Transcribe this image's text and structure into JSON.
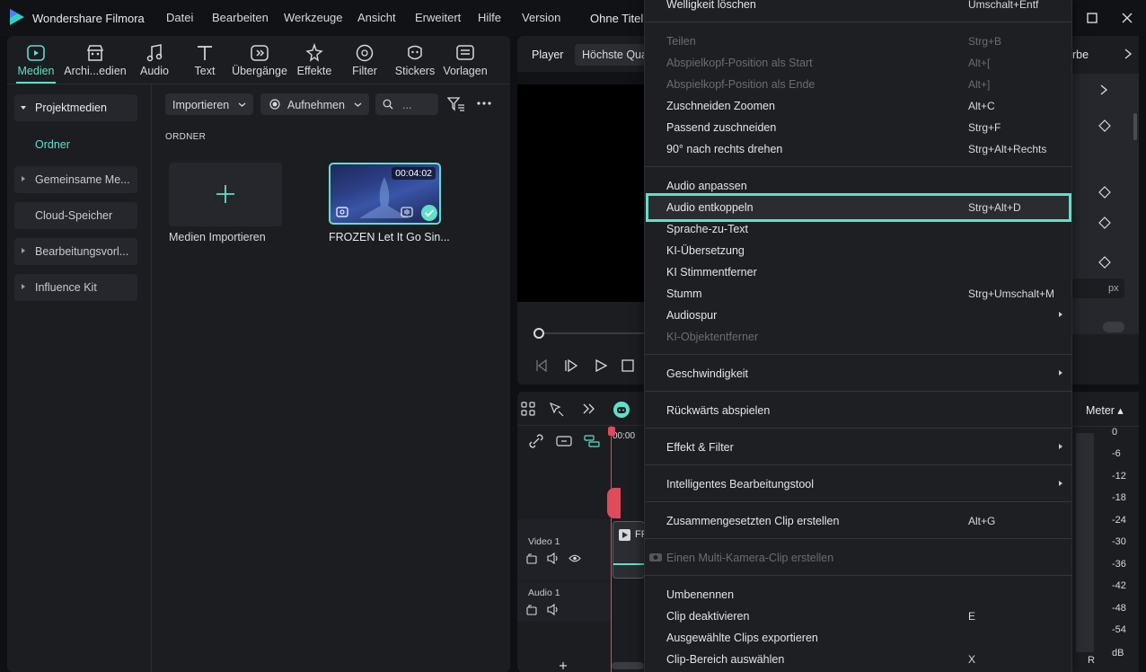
{
  "titlebar": {
    "app_title": "Wondershare Filmora",
    "menus": [
      "Datei",
      "Bearbeiten",
      "Werkzeuge",
      "Ansicht",
      "Erweitert",
      "Hilfe",
      "Version"
    ],
    "doc_title": "Ohne Titel"
  },
  "tabs": [
    {
      "label": "Medien",
      "icon": "media-icon",
      "active": true
    },
    {
      "label": "Archi...edien",
      "icon": "archive-icon"
    },
    {
      "label": "Audio",
      "icon": "music-note-icon"
    },
    {
      "label": "Text",
      "icon": "text-icon"
    },
    {
      "label": "Übergänge",
      "icon": "transition-icon"
    },
    {
      "label": "Effekte",
      "icon": "effects-icon"
    },
    {
      "label": "Filter",
      "icon": "filter-icon"
    },
    {
      "label": "Stickers",
      "icon": "sticker-icon"
    },
    {
      "label": "Vorlagen",
      "icon": "template-icon"
    }
  ],
  "sidebar": {
    "projektmedien": "Projektmedien",
    "ordner": "Ordner",
    "gemeinsame": "Gemeinsame Me...",
    "cloud": "Cloud-Speicher",
    "bearbeitung": "Bearbeitungsvorl...",
    "influence": "Influence Kit"
  },
  "media_toolbar": {
    "import_label": "Importieren",
    "record_label": "Aufnehmen",
    "search_placeholder": "..."
  },
  "media": {
    "section_label": "ORDNER",
    "import_tile_label": "Medien Importieren",
    "clip_label": "FROZEN  Let It Go Sin...",
    "clip_duration": "00:04:02"
  },
  "player": {
    "label": "Player",
    "quality": "Höchste Qualität"
  },
  "timeline": {
    "time": "00:00",
    "video_track": "Video 1",
    "audio_track": "Audio 1",
    "clip_prefix": "FF"
  },
  "right": {
    "tab_partial": "rbe",
    "px_unit": "px",
    "meter_label": "Meter",
    "db_scale": [
      "0",
      "-6",
      "-12",
      "-18",
      "-24",
      "-30",
      "-36",
      "-42",
      "-48",
      "-54",
      "dB"
    ],
    "channel_r": "R"
  },
  "context_menu": {
    "items": [
      {
        "label": "Welligkeit löschen",
        "shortcut": "Umschalt+Entf",
        "disabled": false
      },
      {
        "label": "Teilen",
        "shortcut": "Strg+B",
        "disabled": true
      },
      {
        "label": "Abspielkopf-Position als Start",
        "shortcut": "Alt+[",
        "disabled": true
      },
      {
        "label": "Abspielkopf-Position als Ende",
        "shortcut": "Alt+]",
        "disabled": true
      },
      {
        "label": "Zuschneiden  Zoomen",
        "shortcut": "Alt+C",
        "disabled": false
      },
      {
        "label": "Passend zuschneiden",
        "shortcut": "Strg+F",
        "disabled": false
      },
      {
        "label": "90° nach rechts drehen",
        "shortcut": "Strg+Alt+Rechts",
        "disabled": false
      },
      {
        "label": "Audio anpassen",
        "shortcut": "",
        "disabled": false
      },
      {
        "label": "Audio entkoppeln",
        "shortcut": "Strg+Alt+D",
        "disabled": false,
        "highlighted": true
      },
      {
        "label": "Sprache-zu-Text",
        "shortcut": "",
        "disabled": false
      },
      {
        "label": "KI-Übersetzung",
        "shortcut": "",
        "disabled": false
      },
      {
        "label": "KI Stimmentferner",
        "shortcut": "",
        "disabled": false
      },
      {
        "label": "Stumm",
        "shortcut": "Strg+Umschalt+M",
        "disabled": false
      },
      {
        "label": "Audiospur",
        "shortcut": "",
        "disabled": false,
        "submenu": true
      },
      {
        "label": "KI-Objektentferner",
        "shortcut": "",
        "disabled": true
      },
      {
        "label": "Geschwindigkeit",
        "shortcut": "",
        "disabled": false,
        "submenu": true
      },
      {
        "label": "Rückwärts abspielen",
        "shortcut": "",
        "disabled": false
      },
      {
        "label": "Effekt & Filter",
        "shortcut": "",
        "disabled": false,
        "submenu": true
      },
      {
        "label": "Intelligentes Bearbeitungstool",
        "shortcut": "",
        "disabled": false,
        "submenu": true
      },
      {
        "label": "Zusammengesetzten Clip erstellen",
        "shortcut": "Alt+G",
        "disabled": false
      },
      {
        "label": "Einen Multi-Kamera-Clip erstellen",
        "shortcut": "",
        "disabled": true
      },
      {
        "label": "Umbenennen",
        "shortcut": "",
        "disabled": false
      },
      {
        "label": "Clip deaktivieren",
        "shortcut": "E",
        "disabled": false
      },
      {
        "label": "Ausgewählte Clips exportieren",
        "shortcut": "",
        "disabled": false
      },
      {
        "label": "Clip-Bereich auswählen",
        "shortcut": "X",
        "disabled": false
      }
    ]
  },
  "colors": {
    "accent": "#5fe0c8",
    "playhead": "#e04a5a"
  }
}
